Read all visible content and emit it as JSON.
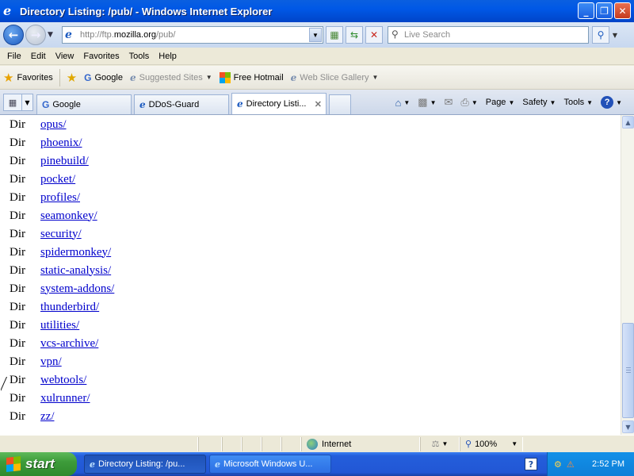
{
  "window": {
    "title": "Directory Listing: /pub/ - Windows Internet Explorer",
    "controls": {
      "minimize": "_",
      "restore": "❐",
      "close": "✕"
    }
  },
  "address_bar": {
    "url_prefix": "http://ftp.",
    "url_domain": "mozilla.org",
    "url_path": "/pub/",
    "search_placeholder": "Live Search"
  },
  "menu": [
    "File",
    "Edit",
    "View",
    "Favorites",
    "Tools",
    "Help"
  ],
  "favorites_bar": {
    "favorites_label": "Favorites",
    "items": [
      {
        "label": "Google",
        "icon": "google-icon"
      },
      {
        "label": "Suggested Sites",
        "icon": "ie-page-icon",
        "dim": true
      },
      {
        "label": "Free Hotmail",
        "icon": "windows-logo-icon"
      },
      {
        "label": "Web Slice Gallery",
        "icon": "ie-page-icon",
        "dim": true
      }
    ]
  },
  "tabs": [
    {
      "label": "Google",
      "active": false,
      "icon": "google-icon"
    },
    {
      "label": "DDoS-Guard",
      "active": false,
      "icon": "ie-page-icon"
    },
    {
      "label": "Directory Listi...",
      "active": true,
      "icon": "ie-page-icon"
    }
  ],
  "command_bar": {
    "page": "Page",
    "safety": "Safety",
    "tools": "Tools"
  },
  "listing": [
    {
      "type": "Dir",
      "name": "opus/"
    },
    {
      "type": "Dir",
      "name": "phoenix/"
    },
    {
      "type": "Dir",
      "name": "pinebuild/"
    },
    {
      "type": "Dir",
      "name": "pocket/"
    },
    {
      "type": "Dir",
      "name": "profiles/"
    },
    {
      "type": "Dir",
      "name": "seamonkey/"
    },
    {
      "type": "Dir",
      "name": "security/"
    },
    {
      "type": "Dir",
      "name": "spidermonkey/"
    },
    {
      "type": "Dir",
      "name": "static-analysis/"
    },
    {
      "type": "Dir",
      "name": "system-addons/"
    },
    {
      "type": "Dir",
      "name": "thunderbird/"
    },
    {
      "type": "Dir",
      "name": "utilities/"
    },
    {
      "type": "Dir",
      "name": "vcs-archive/"
    },
    {
      "type": "Dir",
      "name": "vpn/"
    },
    {
      "type": "Dir",
      "name": "webtools/"
    },
    {
      "type": "Dir",
      "name": "xulrunner/"
    },
    {
      "type": "Dir",
      "name": "zz/"
    }
  ],
  "status_bar": {
    "zone": "Internet",
    "zoom": "100%"
  },
  "taskbar": {
    "start": "start",
    "buttons": [
      {
        "label": "Directory Listing: /pu...",
        "active": true
      },
      {
        "label": "Microsoft Windows U...",
        "active": false
      }
    ],
    "help_glyph": "?",
    "clock": "2:52 PM"
  },
  "colors": {
    "link": "#0000cc",
    "title_bar": "#0058e6",
    "taskbar": "#245edb",
    "start": "#3d9c3a"
  }
}
